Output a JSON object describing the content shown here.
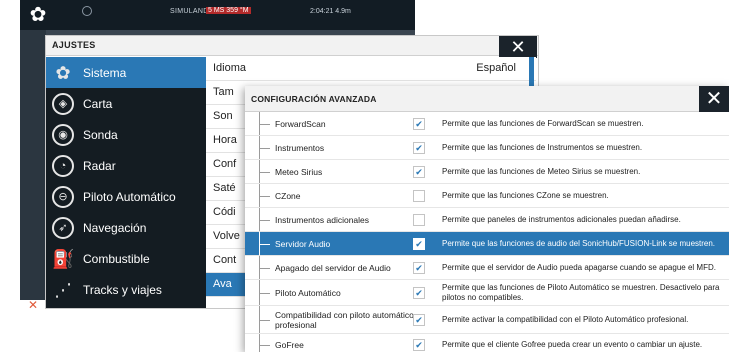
{
  "colors": {
    "accent": "#2a78b5",
    "dark_panel": "#141c22",
    "close_button": "#1b232b",
    "speed_badge": "#b22a2a"
  },
  "device_bar": {
    "simulating": "SIMULANDO...",
    "speed": "5 MS 359 °M",
    "time_depth": "2:04:21  4.9m"
  },
  "ajustes": {
    "title": "AJUSTES",
    "sidebar": [
      {
        "label": "Sistema",
        "icon": "gear-icon",
        "active": true
      },
      {
        "label": "Carta",
        "icon": "chart-icon"
      },
      {
        "label": "Sonda",
        "icon": "sonar-icon"
      },
      {
        "label": "Radar",
        "icon": "radar-icon"
      },
      {
        "label": "Piloto Automático",
        "icon": "steering-wheel-icon"
      },
      {
        "label": "Navegación",
        "icon": "compass-icon"
      },
      {
        "label": "Combustible",
        "icon": "fuel-pump-icon"
      },
      {
        "label": "Tracks y viajes",
        "icon": "tracks-icon"
      }
    ],
    "settings": [
      {
        "label": "Idioma",
        "value": "Español"
      },
      {
        "label": "Tam"
      },
      {
        "label": "Son"
      },
      {
        "label": "Hora"
      },
      {
        "label": "Conf"
      },
      {
        "label": "Saté"
      },
      {
        "label": "Códi"
      },
      {
        "label": "Volve"
      },
      {
        "label": "Cont"
      },
      {
        "label": "Ava"
      }
    ]
  },
  "advanced": {
    "title": "CONFIGURACIÓN AVANZADA",
    "rows": [
      {
        "name": "ForwardScan",
        "checked": true,
        "desc": "Permite que las funciones de ForwardScan se muestren."
      },
      {
        "name": "Instrumentos",
        "checked": true,
        "desc": "Permite que las funciones de Instrumentos se muestren."
      },
      {
        "name": "Meteo Sirius",
        "checked": true,
        "desc": "Permite que las funciones de Meteo Sirius se muestren."
      },
      {
        "name": "CZone",
        "checked": false,
        "desc": "Permite que las funciones CZone se muestren."
      },
      {
        "name": "Instrumentos adicionales",
        "checked": false,
        "desc": "Permite que paneles de instrumentos adicionales puedan añadirse."
      },
      {
        "name": "Servidor Audio",
        "checked": true,
        "active": true,
        "desc": "Permite que las funciones de audio del SonicHub/FUSION-Link se muestren."
      },
      {
        "name": "Apagado del servidor de Audio",
        "checked": true,
        "desc": "Permite que el servidor de Audio pueda apagarse cuando se apague el MFD."
      },
      {
        "name": "Piloto Automático",
        "checked": true,
        "desc": "Permite que las funciones de Piloto Automático se muestren. Desactivelo para pilotos no compatibles."
      },
      {
        "name": "Compatibilidad con piloto automático profesional",
        "checked": true,
        "desc": "Permite activar la compatibilidad con el Piloto Automático profesional."
      },
      {
        "name": "GoFree",
        "checked": true,
        "desc": "Permite que el cliente Gofree pueda crear un evento o cambiar un ajuste."
      }
    ]
  }
}
